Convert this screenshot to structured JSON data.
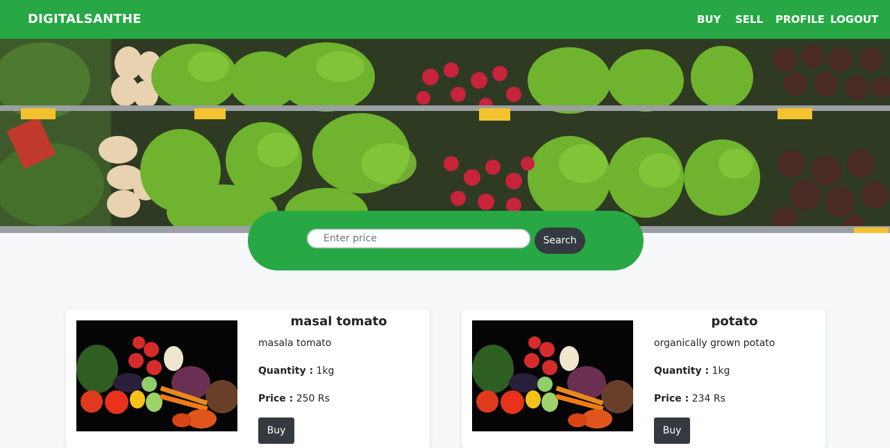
{
  "navbar": {
    "brand": "DIGITALSANTHE",
    "links": [
      "BUY",
      "SELL",
      "PROFILE",
      "LOGOUT"
    ]
  },
  "search": {
    "placeholder": "Enter price",
    "button_label": "Search"
  },
  "products": [
    {
      "title": "masal tomato",
      "description": "masala tomato",
      "quantity_label": "Quantity :",
      "quantity": "1kg",
      "price_label": "Price :",
      "price": "250 Rs",
      "buy_label": "Buy"
    },
    {
      "title": "potato",
      "description": "organically grown potato",
      "quantity_label": "Quantity :",
      "quantity": "1kg",
      "price_label": "Price :",
      "price": "234 Rs",
      "buy_label": "Buy"
    }
  ],
  "colors": {
    "brand_green": "#27a844",
    "dark_button": "#343a40",
    "page_background": "#f7f8fa"
  }
}
